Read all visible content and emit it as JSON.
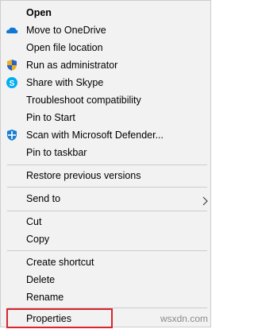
{
  "menu": {
    "items": [
      {
        "label": "Open"
      },
      {
        "label": "Move to OneDrive",
        "icon": "onedrive-icon"
      },
      {
        "label": "Open file location"
      },
      {
        "label": "Run as administrator",
        "icon": "shield-icon"
      },
      {
        "label": "Share with Skype",
        "icon": "skype-icon"
      },
      {
        "label": "Troubleshoot compatibility"
      },
      {
        "label": "Pin to Start"
      },
      {
        "label": "Scan with Microsoft Defender...",
        "icon": "defender-icon"
      },
      {
        "label": "Pin to taskbar"
      },
      {
        "label": "Restore previous versions"
      },
      {
        "label": "Send to",
        "icon": "chevron-right-icon"
      },
      {
        "label": "Cut"
      },
      {
        "label": "Copy"
      },
      {
        "label": "Create shortcut"
      },
      {
        "label": "Delete"
      },
      {
        "label": "Rename"
      },
      {
        "label": "Properties"
      }
    ]
  },
  "watermark": "wsxdn.com",
  "colors": {
    "menu_bg": "#f2f2f2",
    "highlight": "#d9252e",
    "onedrive": "#0f78d4",
    "skype": "#00aff0",
    "defender": "#1a7fd4"
  }
}
